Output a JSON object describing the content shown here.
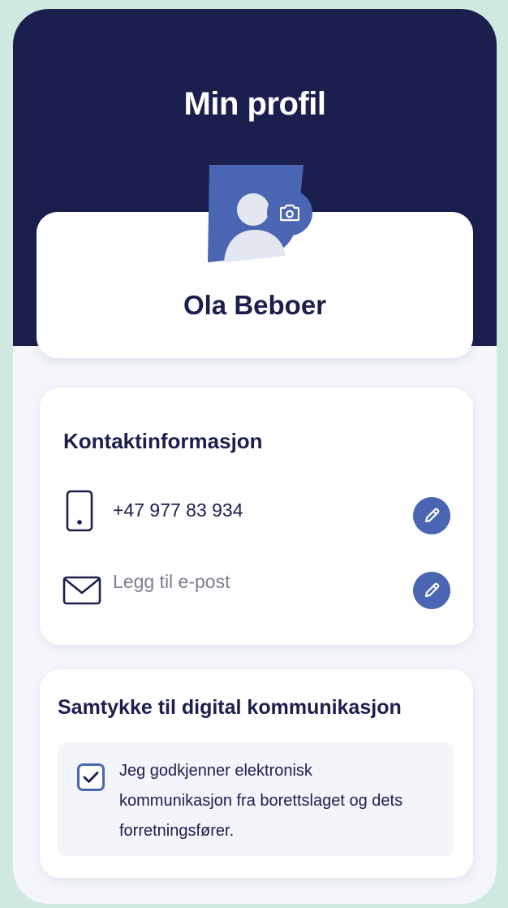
{
  "header": {
    "title": "Min profil"
  },
  "profile": {
    "name": "Ola Beboer",
    "avatar_icon": "user-placeholder-icon",
    "camera_icon": "camera-icon"
  },
  "contact": {
    "title": "Kontaktinformasjon",
    "phone": {
      "icon": "mobile-phone-icon",
      "value": "+47 977 83 934",
      "edit_icon": "pencil-icon"
    },
    "email": {
      "icon": "envelope-icon",
      "placeholder": "Legg til e-post",
      "edit_icon": "pencil-icon"
    }
  },
  "consent": {
    "title": "Samtykke til digital kommunikasjon",
    "checked": true,
    "text": "Jeg godkjenner elektronisk kommunikasjon fra borettslaget og dets forretningsfører."
  },
  "colors": {
    "header_bg": "#1a1f4e",
    "accent": "#4a66b3",
    "page_bg": "#f4f6fb",
    "outer_bg": "#cfe8e0"
  }
}
